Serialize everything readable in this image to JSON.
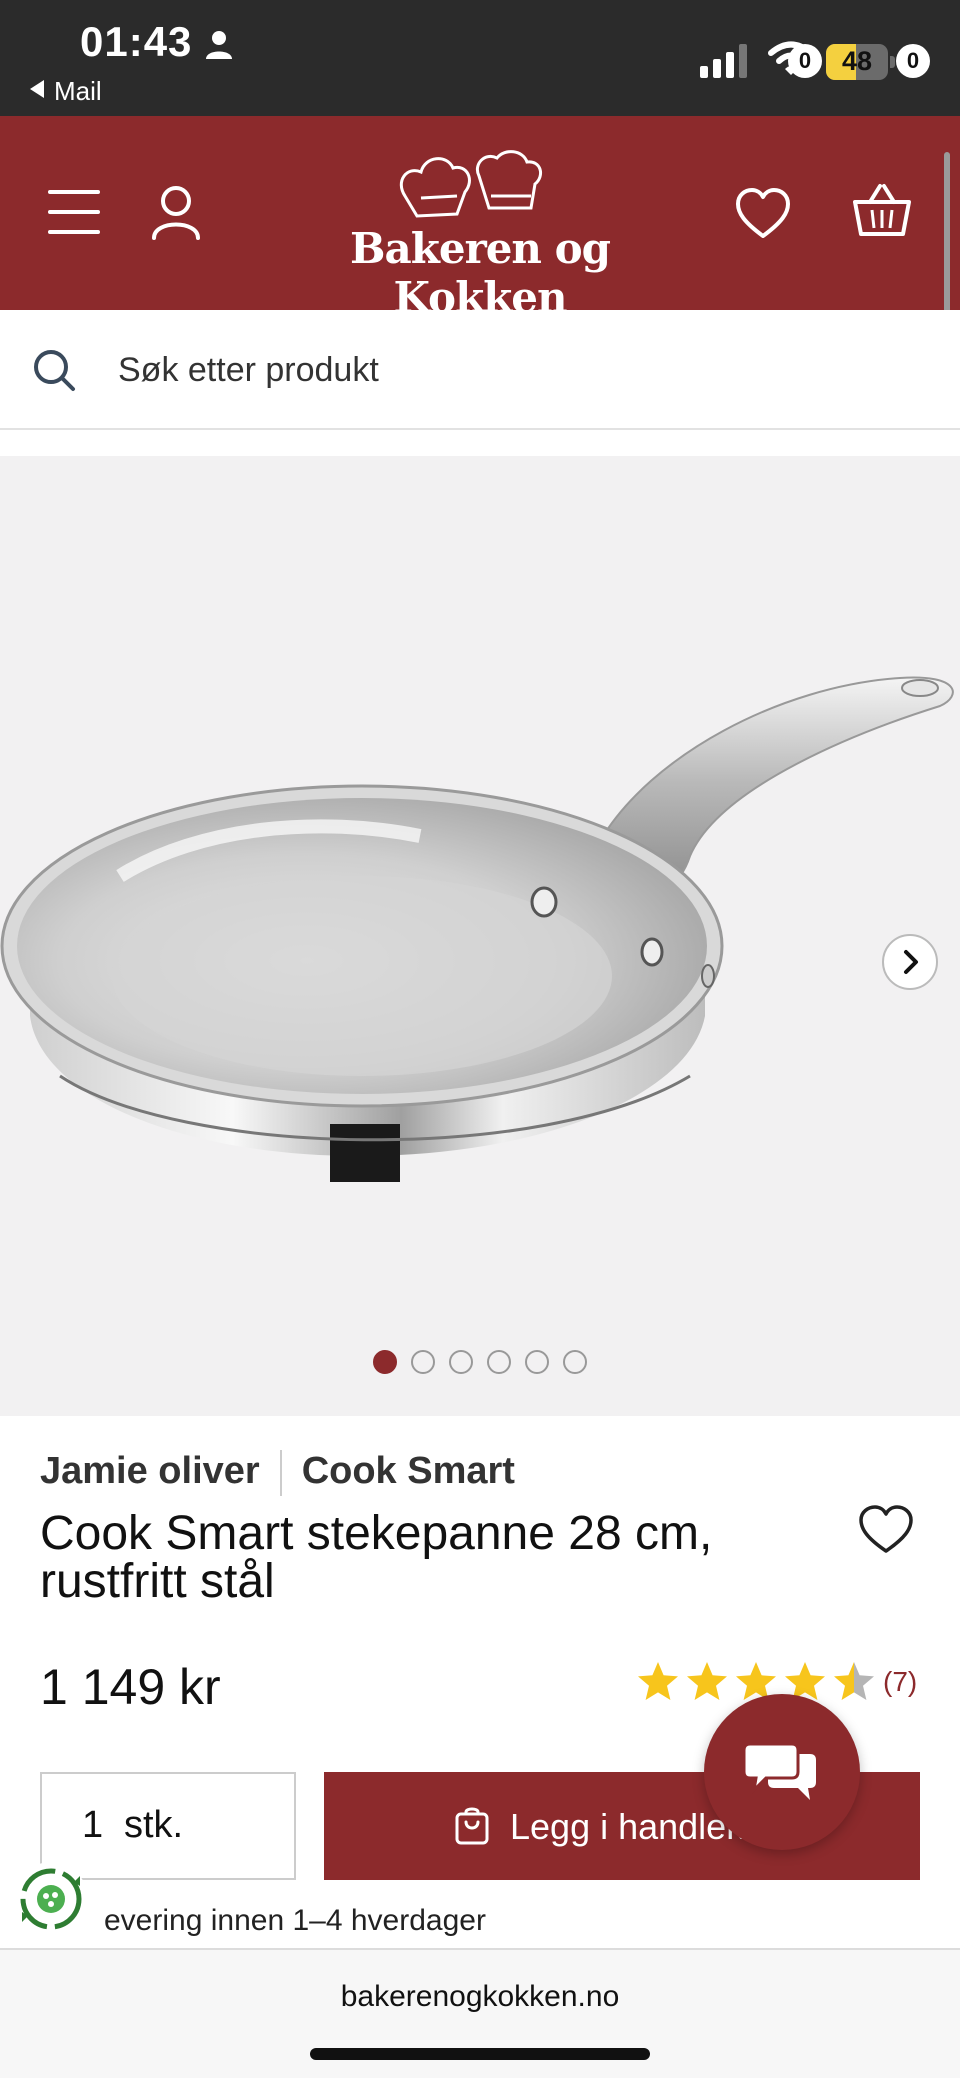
{
  "status_bar": {
    "time": "01:43",
    "back_label": "Mail",
    "battery": "48",
    "battery_level": 0.48
  },
  "header": {
    "logo_text": "Bakeren og Kokken",
    "favorites_count": "0",
    "cart_count": "0"
  },
  "colors": {
    "brand": "#8c2a2c",
    "star": "#f7c51c",
    "star_empty": "#b5b5b5"
  },
  "search": {
    "placeholder": "Søk etter produkt"
  },
  "gallery": {
    "image_count": 6,
    "active_index": 0
  },
  "product": {
    "brand": "Jamie oliver",
    "series": "Cook Smart",
    "title": "Cook Smart stekepanne 28 cm, rustfritt stål",
    "price": "1 149 kr",
    "rating": 4.5,
    "rating_max": 5,
    "rating_count": "(7)"
  },
  "purchase": {
    "quantity": "1",
    "unit": "stk.",
    "add_label": "Legg i handlek"
  },
  "delivery": {
    "text": "evering innen 1–4 hverdager"
  },
  "browser": {
    "url": "bakerenogkokken.no"
  }
}
